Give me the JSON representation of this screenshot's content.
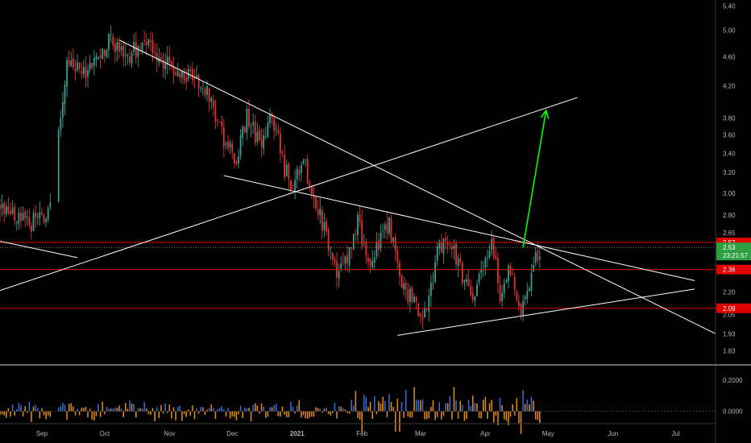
{
  "chart_data": [
    {
      "type": "candlestick",
      "title": "",
      "price_axis": {
        "scale": "log",
        "range": [
          1.75,
          5.5
        ],
        "ticks": [
          "5.40",
          "5.00",
          "4.60",
          "4.20",
          "3.80",
          "3.60",
          "3.40",
          "3.20",
          "3.00",
          "2.80",
          "2.65",
          "2.20",
          "2.05",
          "1.93",
          "1.83"
        ]
      },
      "time_axis": {
        "labels": [
          "Sep",
          "Oct",
          "Nov",
          "Dec",
          "2021",
          "Feb",
          "Mar",
          "Apr",
          "May",
          "Jun",
          "Jul"
        ],
        "range": [
          "2020-08-12",
          "2021-07-20"
        ]
      },
      "price_markers": [
        {
          "value": "2.57",
          "color": "#e00000"
        },
        {
          "value": "2.53",
          "sub": "23:21:57",
          "color": "#2ea043"
        },
        {
          "value": "2.36",
          "color": "#e00000"
        },
        {
          "value": "2.09",
          "color": "#e00000"
        }
      ],
      "horizontal_levels": [
        {
          "value": 2.57,
          "color": "#e00000"
        },
        {
          "value": 2.36,
          "color": "#e00000"
        },
        {
          "value": 2.09,
          "color": "#e00000"
        }
      ],
      "current_price": 2.53,
      "trendlines": [
        {
          "from": [
            "2020-08-12",
            2.58
          ],
          "to": [
            "2020-09-18",
            2.45
          ],
          "color": "#ffffff"
        },
        {
          "from": [
            "2020-08-12",
            2.21
          ],
          "to": [
            "2021-05-15",
            4.05
          ],
          "color": "#ffffff"
        },
        {
          "from": [
            "2020-10-08",
            4.85
          ],
          "to": [
            "2021-07-20",
            1.93
          ],
          "color": "#ffffff"
        },
        {
          "from": [
            "2020-11-27",
            3.17
          ],
          "to": [
            "2021-07-10",
            2.28
          ],
          "color": "#ffffff"
        },
        {
          "from": [
            "2021-02-18",
            1.92
          ],
          "to": [
            "2021-07-10",
            2.22
          ],
          "color": "#ffffff"
        },
        {
          "from": [
            "2021-04-19",
            2.53
          ],
          "to": [
            "2021-04-30",
            3.89
          ],
          "color": "#00ff00",
          "arrow": true
        }
      ],
      "colors": {
        "up": "#3c9e8f",
        "down": "#e0322f",
        "background": "#000000",
        "grid": false
      }
    },
    {
      "type": "bar",
      "name": "volume-oscillator",
      "y_axis": {
        "ticks": [
          "0.2000",
          "0.0000"
        ],
        "range": [
          -0.08,
          0.3
        ]
      },
      "colors": {
        "positive": "#3a6bd0",
        "negative": "#e08a1e"
      }
    }
  ]
}
